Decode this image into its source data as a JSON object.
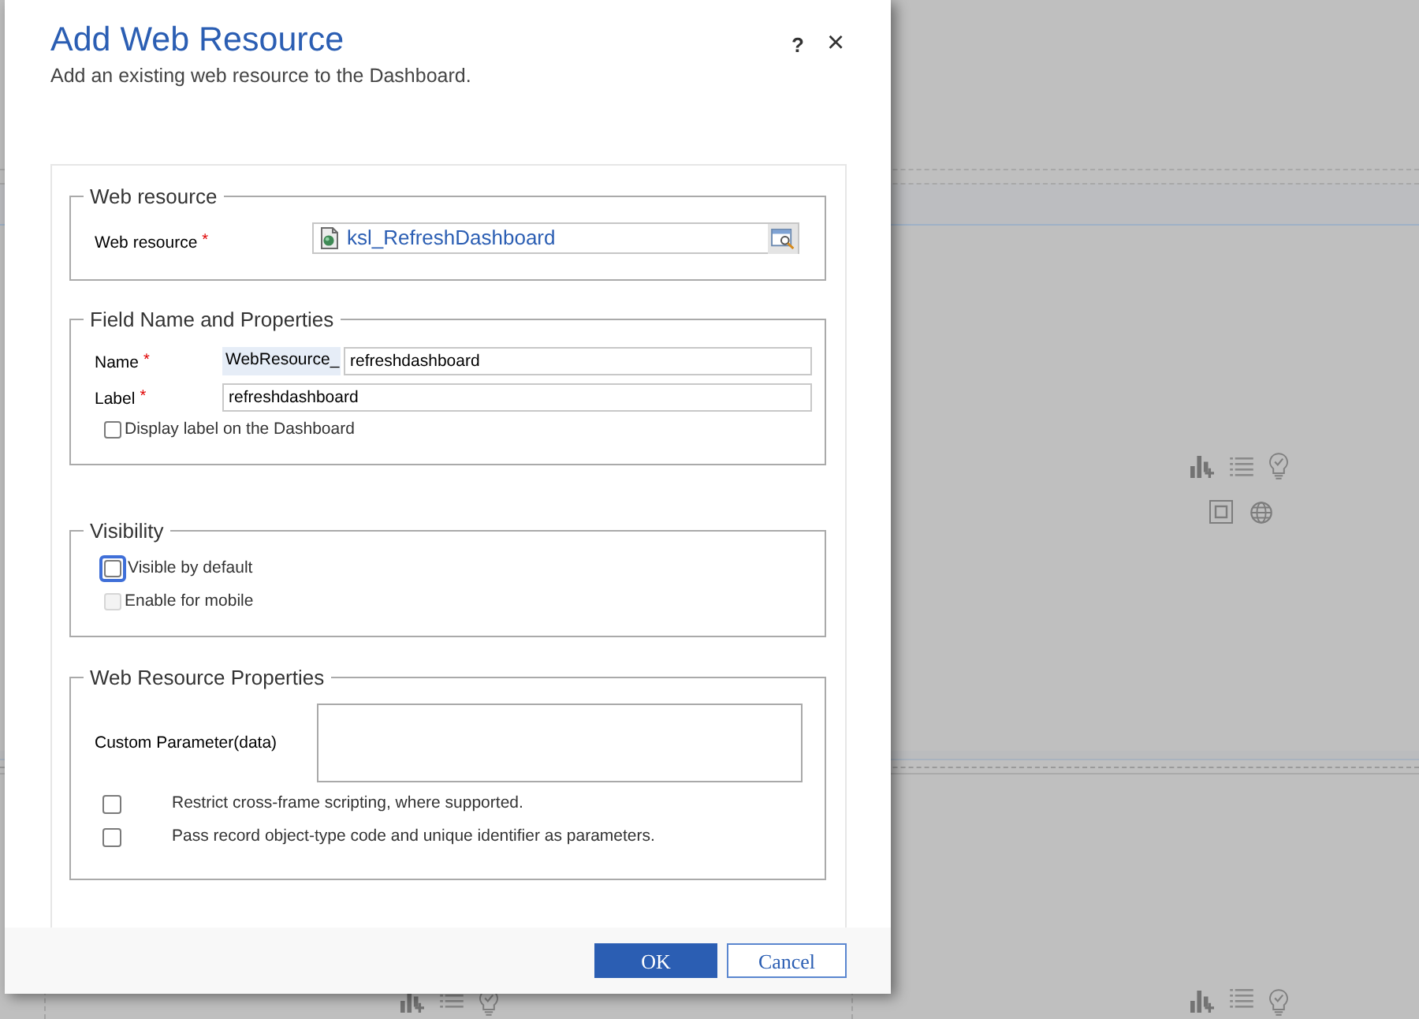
{
  "dialog": {
    "title": "Add Web Resource",
    "subtitle": "Add an existing web resource to the Dashboard.",
    "help_button": "?",
    "close_button": "×"
  },
  "sections": [
    {
      "legend": "Web resource",
      "fields": [
        {
          "kind": "lookup",
          "label": "Web resource",
          "required_mark": "*",
          "value": "ksl_RefreshDashboard"
        }
      ]
    },
    {
      "legend": "Field Name and Properties",
      "fields": [
        {
          "kind": "prefixed",
          "label": "Name",
          "required_mark": "*",
          "prefix": "WebResource_",
          "value": "refreshdashboard"
        },
        {
          "kind": "text",
          "label": "Label",
          "required_mark": "*",
          "value": "refreshdashboard"
        },
        {
          "kind": "checkbox",
          "label": "Display label on the Dashboard",
          "checked": false,
          "disabled": false,
          "focused": false
        }
      ]
    },
    {
      "legend": "Visibility",
      "fields": [
        {
          "kind": "checkbox",
          "label": "Visible by default",
          "checked": false,
          "disabled": false,
          "focused": true
        },
        {
          "kind": "checkbox",
          "label": "Enable for mobile",
          "checked": false,
          "disabled": true,
          "focused": false
        }
      ]
    },
    {
      "legend": "Web Resource Properties",
      "fields": [
        {
          "kind": "textarea",
          "label": "Custom Parameter(data)"
        },
        {
          "kind": "option",
          "label": "Restrict cross-frame scripting, where supported.",
          "checked": false,
          "disabled": false,
          "focused": false
        },
        {
          "kind": "option",
          "label": "Pass record object-type code and unique identifier as parameters.",
          "checked": false,
          "disabled": false,
          "focused": false
        }
      ]
    }
  ],
  "buttons": [
    {
      "label": "OK",
      "kind": "primary"
    },
    {
      "label": "Cancel",
      "kind": "secondary"
    }
  ]
}
